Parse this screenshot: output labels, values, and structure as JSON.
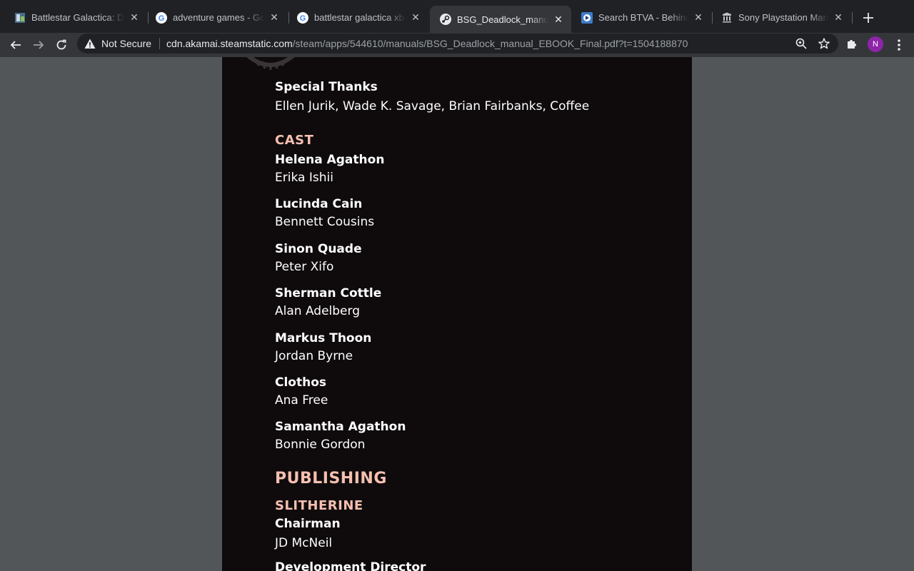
{
  "browser": {
    "tabs": [
      {
        "title": "Battlestar Galactica: De",
        "favicon": "bsg-favicon-icon",
        "active": false
      },
      {
        "title": "adventure games - Goo",
        "favicon": "google-icon",
        "active": false
      },
      {
        "title": "battlestar galactica xbo",
        "favicon": "google-icon",
        "active": false
      },
      {
        "title": "BSG_Deadlock_manual_",
        "favicon": "steam-icon",
        "active": true
      },
      {
        "title": "Search BTVA - Behind",
        "favicon": "btva-icon",
        "active": false
      },
      {
        "title": "Sony Playstation Manu",
        "favicon": "archive-icon",
        "active": false
      }
    ],
    "security_label": "Not Secure",
    "url_host": "cdn.akamai.steamstatic.com",
    "url_path": "/steam/apps/544610/manuals/BSG_Deadlock_manual_EBOOK_Final.pdf?t=1504188870",
    "profile_initial": "N",
    "profile_color": "#8e24aa"
  },
  "pdf": {
    "special_thanks": {
      "role": "Special Thanks",
      "names": "Ellen Jurik, Wade K. Savage, Brian Fairbanks, Coffee"
    },
    "cast_heading": "CAST",
    "cast": [
      {
        "role": "Helena Agathon",
        "person": "Erika Ishii"
      },
      {
        "role": "Lucinda Cain",
        "person": "Bennett Cousins"
      },
      {
        "role": "Sinon Quade",
        "person": "Peter Xifo"
      },
      {
        "role": "Sherman Cottle",
        "person": "Alan Adelberg"
      },
      {
        "role": "Markus Thoon",
        "person": "Jordan Byrne"
      },
      {
        "role": "Clothos",
        "person": "Ana Free"
      },
      {
        "role": "Samantha Agathon",
        "person": "Bonnie Gordon"
      }
    ],
    "publishing_heading": "PUBLISHING",
    "publisher_heading": "SLITHERINE",
    "chairman": {
      "role": "Chairman",
      "person": "JD McNeil"
    },
    "next_role": "Development Director",
    "heading_color": "#f5c0b0"
  }
}
